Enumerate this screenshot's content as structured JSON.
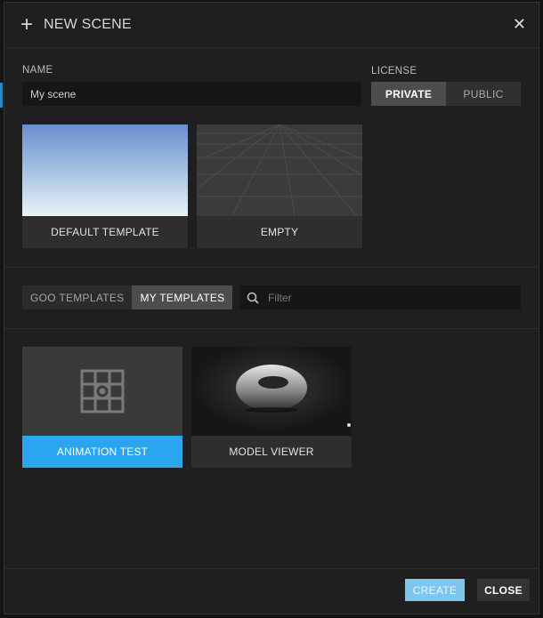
{
  "dialog": {
    "title": "NEW SCENE",
    "add_icon": "plus-icon",
    "close_icon": "close-icon"
  },
  "name_field": {
    "label": "NAME",
    "value": "My scene"
  },
  "license": {
    "label": "LICENSE",
    "options": [
      "PRIVATE",
      "PUBLIC"
    ],
    "selected": "PRIVATE"
  },
  "templates": [
    {
      "label": "DEFAULT TEMPLATE",
      "thumbnail": "sky-gradient"
    },
    {
      "label": "EMPTY",
      "thumbnail": "grid-floor"
    }
  ],
  "template_tabs": {
    "items": [
      "GOO TEMPLATES",
      "MY TEMPLATES"
    ],
    "selected": "MY TEMPLATES"
  },
  "filter": {
    "placeholder": "Filter",
    "value": "",
    "icon": "search-icon"
  },
  "my_templates": [
    {
      "label": "ANIMATION TEST",
      "thumbnail": "scene-icon",
      "selected": true
    },
    {
      "label": "MODEL VIEWER",
      "thumbnail": "torus-render",
      "selected": false
    }
  ],
  "footer": {
    "create_label": "CREATE",
    "close_label": "CLOSE"
  },
  "colors": {
    "accent": "#2aa6ee",
    "create_button": "#7cc6f0",
    "dialog_bg": "#1f1f1f"
  }
}
